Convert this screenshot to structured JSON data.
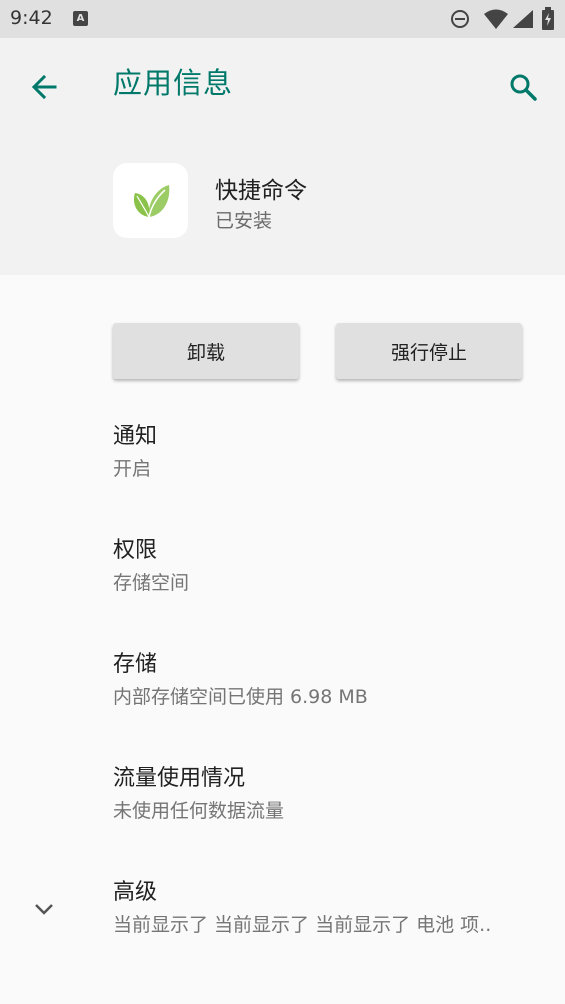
{
  "status_bar": {
    "time": "9:42",
    "notification_icon": "a-letter-icon",
    "icons": [
      "do-not-disturb-icon",
      "wifi-icon",
      "signal-icon",
      "battery-icon"
    ]
  },
  "header": {
    "title": "应用信息",
    "back_icon": "arrow-back-icon",
    "search_icon": "search-icon",
    "accent_color": "#00796b"
  },
  "app": {
    "name": "快捷命令",
    "status": "已安装",
    "icon": "leaf-icon"
  },
  "buttons": {
    "uninstall": "卸载",
    "force_stop": "强行停止"
  },
  "settings": [
    {
      "title": "通知",
      "subtitle": "开启"
    },
    {
      "title": "权限",
      "subtitle": "存储空间"
    },
    {
      "title": "存储",
      "subtitle": "内部存储空间已使用 6.98 MB"
    },
    {
      "title": "流量使用情况",
      "subtitle": "未使用任何数据流量"
    },
    {
      "title": "高级",
      "subtitle": "当前显示了 当前显示了 当前显示了 电池 项.."
    }
  ]
}
